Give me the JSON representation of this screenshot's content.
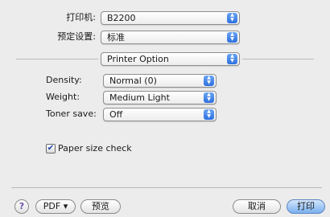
{
  "top": {
    "printer_label": "打印机:",
    "printer_value": "B2200",
    "presets_label": "预定设置:",
    "presets_value": "标准",
    "section_value": "Printer Option"
  },
  "options": {
    "density_label": "Density:",
    "density_value": "Normal (0)",
    "weight_label": "Weight:",
    "weight_value": "Medium Light",
    "toner_label": "Toner save:",
    "toner_value": "Off",
    "paper_check_label": "Paper size check",
    "paper_check_checked": true
  },
  "footer": {
    "help_label": "?",
    "pdf_label": "PDF ▾",
    "preview_label": "预览",
    "cancel_label": "取消",
    "print_label": "打印"
  },
  "glyphs": {
    "popup_up": "▲",
    "popup_down": "▼",
    "check": "✔"
  },
  "colors": {
    "window_bg": "#ececec",
    "popup_arrow_accent": "#2d6fe0",
    "default_button": "#79b0ef"
  }
}
